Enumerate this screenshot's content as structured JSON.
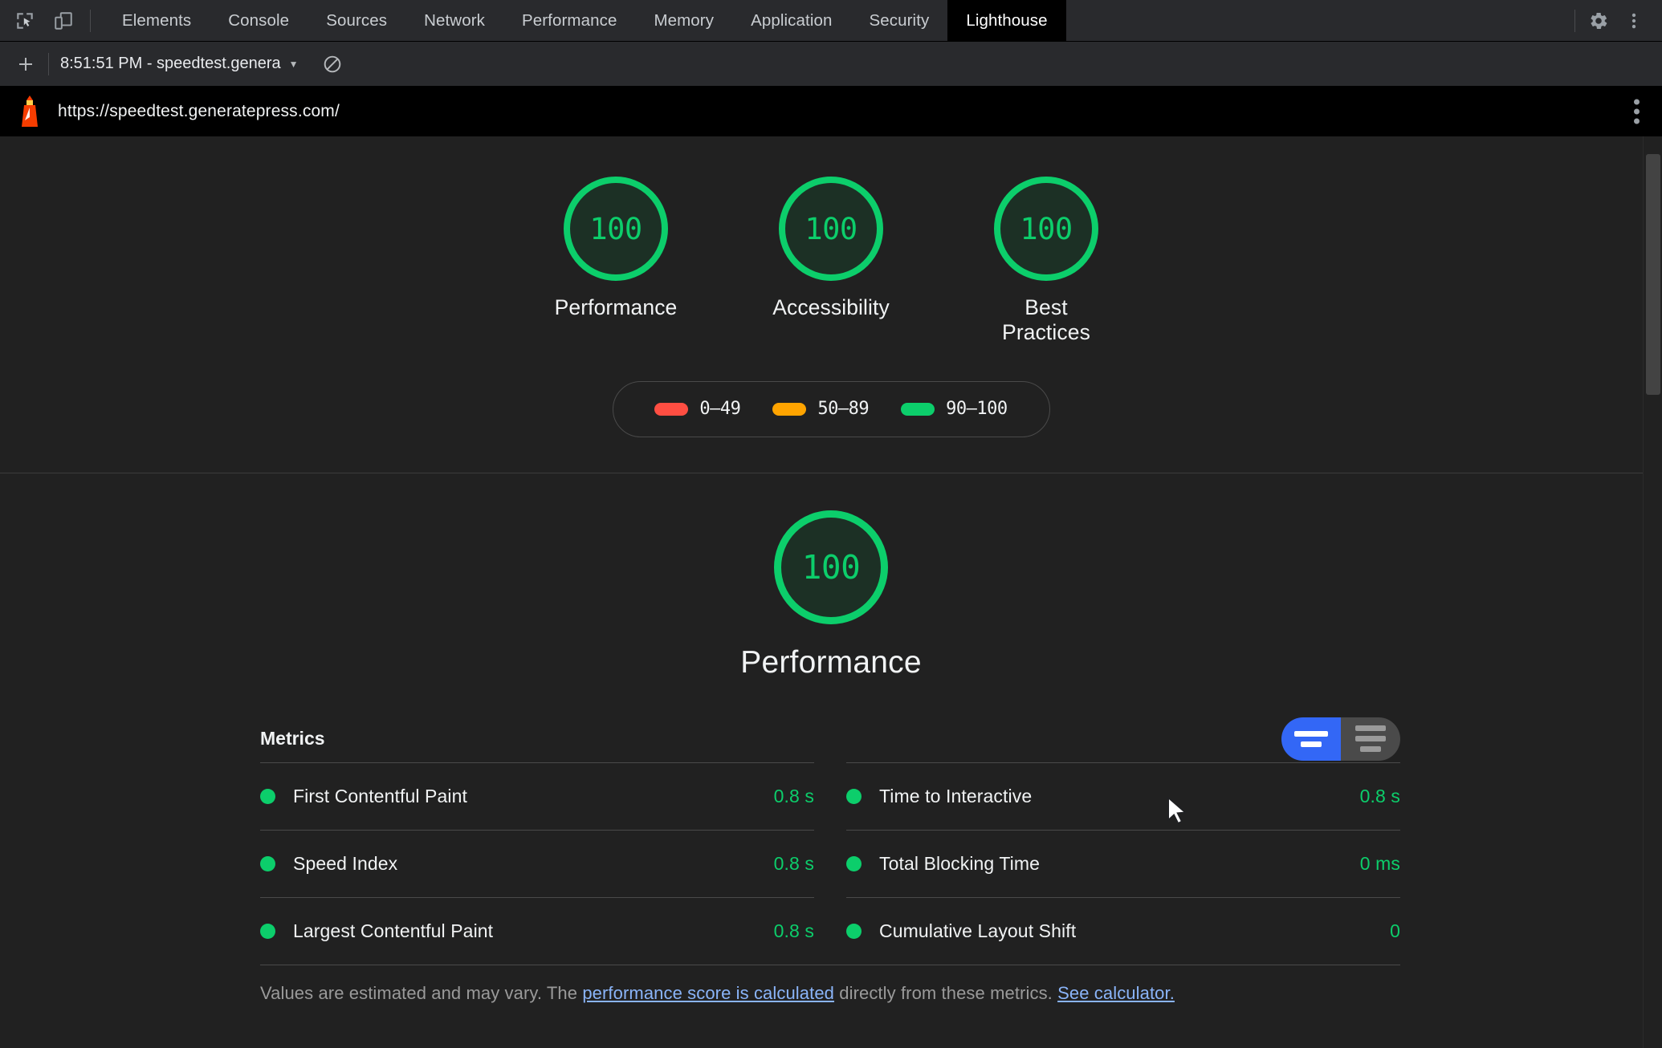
{
  "devtools": {
    "icons": {
      "inspect": "inspect-element-icon",
      "device": "device-toolbar-icon",
      "settings": "gear-icon",
      "more": "more-vertical-icon"
    },
    "tabs": [
      {
        "label": "Elements",
        "active": false
      },
      {
        "label": "Console",
        "active": false
      },
      {
        "label": "Sources",
        "active": false
      },
      {
        "label": "Network",
        "active": false
      },
      {
        "label": "Performance",
        "active": false
      },
      {
        "label": "Memory",
        "active": false
      },
      {
        "label": "Application",
        "active": false
      },
      {
        "label": "Security",
        "active": false
      },
      {
        "label": "Lighthouse",
        "active": true
      }
    ]
  },
  "lighthouse_toolbar": {
    "add_label": "+",
    "report_selector": "8:51:51 PM - speedtest.genera",
    "caret": "▼",
    "clear_icon": "clear-reports-icon"
  },
  "report_header": {
    "url": "https://speedtest.generatepress.com/",
    "logo": "lighthouse-logo-icon",
    "menu": "report-options-icon"
  },
  "scores": {
    "gauges": [
      {
        "label": "Performance",
        "score": "100"
      },
      {
        "label": "Accessibility",
        "score": "100"
      },
      {
        "label": "Best\nPractices",
        "score": "100"
      }
    ],
    "legend": [
      {
        "range": "0–49",
        "color": "#ff4e42"
      },
      {
        "range": "50–89",
        "color": "#ffa400"
      },
      {
        "range": "90–100",
        "color": "#0cce6b"
      }
    ]
  },
  "category": {
    "score": "100",
    "title": "Performance",
    "metrics_heading": "Metrics",
    "toggle": {
      "expand_view": "simple-view-toggle",
      "detail_view": "detailed-view-toggle"
    },
    "metrics": [
      {
        "name": "First Contentful Paint",
        "value": "0.8 s",
        "status": "pass"
      },
      {
        "name": "Time to Interactive",
        "value": "0.8 s",
        "status": "pass"
      },
      {
        "name": "Speed Index",
        "value": "0.8 s",
        "status": "pass"
      },
      {
        "name": "Total Blocking Time",
        "value": "0 ms",
        "status": "pass"
      },
      {
        "name": "Largest Contentful Paint",
        "value": "0.8 s",
        "status": "pass"
      },
      {
        "name": "Cumulative Layout Shift",
        "value": "0",
        "status": "pass"
      }
    ],
    "footnote": {
      "part1": "Values are estimated and may vary. The ",
      "link1": "performance score is calculated",
      "part2": " directly from these metrics. ",
      "link2": "See calculator."
    }
  },
  "colors": {
    "pass": "#0cce6b",
    "average": "#ffa400",
    "fail": "#ff4e42",
    "accent": "#3367f6",
    "link": "#8ab4f8"
  }
}
